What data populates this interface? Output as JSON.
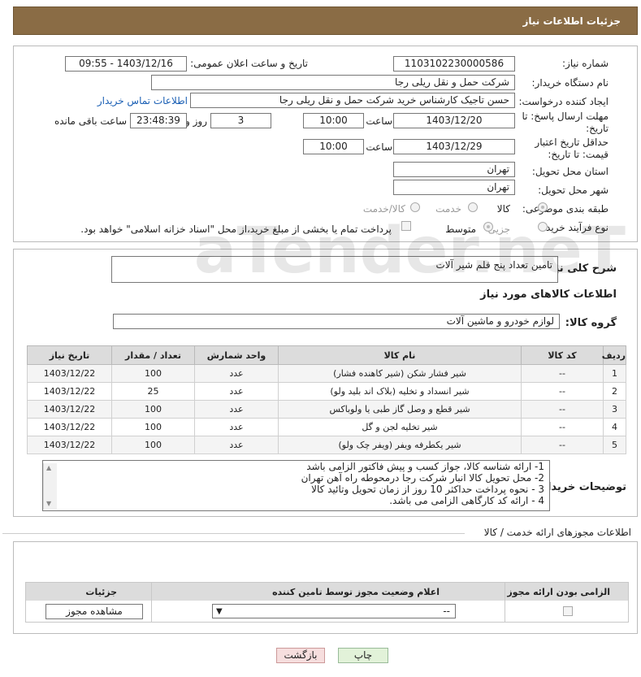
{
  "header": {
    "title": "جزئیات اطلاعات نیاز"
  },
  "form": {
    "need_number": {
      "label": "شماره نیاز:",
      "value": "1103102230000586"
    },
    "announce_datetime": {
      "label": "تاریخ و ساعت اعلان عمومی:",
      "value": "1403/12/16 - 09:55"
    },
    "buyer_org": {
      "label": "نام دستگاه خریدار:",
      "value": "شرکت حمل و نقل ریلی رجا"
    },
    "requester": {
      "label": "ایجاد کننده درخواست:",
      "value": "حسن تاجیک کارشناس خرید شرکت حمل و نقل ریلی رجا"
    },
    "contact_link": "اطلاعات تماس خریدار",
    "reply_deadline": {
      "label": "مهلت ارسال پاسخ: تا تاریخ:",
      "date": "1403/12/20",
      "time_label": "ساعت",
      "time": "10:00",
      "days": "3",
      "days_label": "روز و",
      "remaining": "23:48:39",
      "remaining_label": "ساعت باقی مانده"
    },
    "price_validity": {
      "label": "حداقل تاریخ اعتبار قیمت: تا تاریخ:",
      "date": "1403/12/29",
      "time_label": "ساعت",
      "time": "10:00"
    },
    "delivery_province": {
      "label": "استان محل تحویل:",
      "value": "تهران"
    },
    "delivery_city": {
      "label": "شهر محل تحویل:",
      "value": "تهران"
    },
    "category": {
      "label": "طبقه بندی موضوعی:",
      "options": [
        "کالا",
        "خدمت",
        "کالا/خدمت"
      ],
      "selected": "کالا"
    },
    "purchase_type": {
      "label": "نوع فرآیند خرید :",
      "options": [
        "جزیی",
        "متوسط"
      ],
      "selected": "متوسط",
      "payment_note": "پرداخت تمام یا بخشی از مبلغ خرید،از محل \"اسناد خزانه اسلامی\" خواهد بود."
    }
  },
  "description": {
    "label": "شرح کلی نیاز:",
    "value": "تامین تعداد پنج قلم شیر آلات"
  },
  "goods_section": {
    "title": "اطلاعات کالاهای مورد نیاز",
    "group_label": "گروه کالا:",
    "group_value": "لوازم خودرو و ماشین آلات",
    "columns": [
      "ردیف",
      "کد کالا",
      "نام کالا",
      "واحد شمارش",
      "تعداد / مقدار",
      "تاریخ نیاز"
    ],
    "rows": [
      [
        "1",
        "--",
        "شیر فشار شکن (شیر کاهنده فشار)",
        "عدد",
        "100",
        "1403/12/22"
      ],
      [
        "2",
        "--",
        "شیر انسداد و تخلیه (بلاک اند بلید ولو)",
        "عدد",
        "25",
        "1403/12/22"
      ],
      [
        "3",
        "--",
        "شیر قطع و وصل گاز طبی یا ولوباکس",
        "عدد",
        "100",
        "1403/12/22"
      ],
      [
        "4",
        "--",
        "شیر تخلیه لجن و گل",
        "عدد",
        "100",
        "1403/12/22"
      ],
      [
        "5",
        "--",
        "شیر یکطرفه ویفر (ویفر چک ولو)",
        "عدد",
        "100",
        "1403/12/22"
      ]
    ]
  },
  "buyer_notes": {
    "label": "توضیحات خریدار:",
    "lines": [
      "1- ارائه شناسه کالا، جواز کسب و پیش فاکتور الزامی باشد",
      "2- محل تحویل کالا انبار شرکت رجا درمحوطه راه آهن تهران",
      "3 - نحوه پرداخت حداکثر 10 روز از زمان تحویل وتائید کالا",
      "4 - ارائه کد کارگاهی الزامی می باشد."
    ]
  },
  "permits": {
    "title": "اطلاعات مجوزهای ارائه خدمت / کالا",
    "columns": [
      "الزامی بودن ارائه مجوز",
      "اعلام وضعیت مجوز توسط تامین کننده",
      "جزئیات"
    ],
    "select_value": "--",
    "view_button": "مشاهده مجوز"
  },
  "buttons": {
    "print": "چاپ",
    "back": "بازگشت"
  },
  "watermark": "AriaTender.neT"
}
